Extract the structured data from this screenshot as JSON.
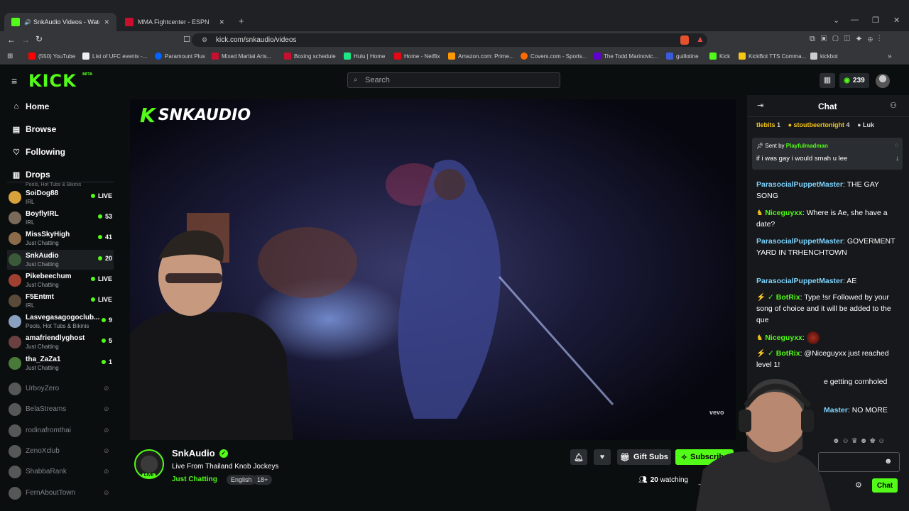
{
  "browser": {
    "tabs": [
      {
        "title": "SnkAudio Videos - Watch On",
        "active": true
      },
      {
        "title": "MMA Fightcenter - ESPN",
        "active": false
      }
    ],
    "url": "kick.com/snkaudio/videos",
    "bookmarks": [
      "(550) YouTube",
      "List of UFC events -...",
      "Paramount Plus",
      "Mixed Martial Arts...",
      "Boxing schedule",
      "Hulu | Home",
      "Home - Netflix",
      "Amazon.com: Prime...",
      "Covers.com - Sports...",
      "The Todd Marinovic...",
      "guillotine",
      "Kick",
      "KickBot TTS Comma..."
    ]
  },
  "header": {
    "logo": "KICK",
    "logo_badge": "BETA",
    "search_placeholder": "Search",
    "points": "239"
  },
  "sidebar": {
    "nav": [
      {
        "label": "Home",
        "icon": "home-icon"
      },
      {
        "label": "Browse",
        "icon": "browse-icon"
      },
      {
        "label": "Following",
        "icon": "heart-icon"
      },
      {
        "label": "Drops",
        "icon": "drops-icon"
      }
    ],
    "cutoff_category": "Pools, Hot Tubs & Bikinis",
    "channels": [
      {
        "name": "SoiDog88",
        "category": "IRL",
        "status": "LIVE"
      },
      {
        "name": "BoyflyIRL",
        "category": "IRL",
        "status": "53"
      },
      {
        "name": "MissSkyHigh",
        "category": "Just Chatting",
        "status": "41"
      },
      {
        "name": "SnkAudio",
        "category": "Just Chatting",
        "status": "20"
      },
      {
        "name": "Pikebeechum",
        "category": "Just Chatting",
        "status": "LIVE"
      },
      {
        "name": "F5Entmt",
        "category": "IRL",
        "status": "LIVE"
      },
      {
        "name": "Lasvegasagogoclub...",
        "category": "Pools, Hot Tubs & Bikinis",
        "status": "9"
      },
      {
        "name": "amafriendlyghost",
        "category": "Just Chatting",
        "status": "5"
      },
      {
        "name": "tha_ZaZa1",
        "category": "Just Chatting",
        "status": "1"
      }
    ],
    "offline": [
      "UrboyZero",
      "BelaStreams",
      "rodinafromthai",
      "ZenoXclub",
      "ShabbaRank",
      "FernAboutTown"
    ]
  },
  "video": {
    "watermark": "SNKAUDIO",
    "vevo": "vevo"
  },
  "stream": {
    "channel_name": "SnkAudio",
    "title": "Live From Thailand Knob Jockeys",
    "category": "Just Chatting",
    "tags": [
      "English",
      "18+"
    ],
    "live_badge": "LIVE",
    "gift_label": "Gift Subs",
    "subscribe_label": "Subscribe",
    "viewers": "20",
    "watching_label": "watching"
  },
  "chat": {
    "title": "Chat",
    "gifters": [
      {
        "name": "tlebits",
        "count": "1"
      },
      {
        "name": "stoutbeertonight",
        "count": "4"
      },
      {
        "name": "Luk",
        "count": ""
      }
    ],
    "pinned_prefix": "Sent by",
    "pinned_user": "Playfulmadman",
    "pinned_text": "if i was gay i would smah u lee",
    "messages": [
      {
        "user": "ParasocialPuppetMaster",
        "text": "THE GAY SONG",
        "color": "#7dd3fc"
      },
      {
        "user": "Niceguyxx",
        "text": "Where is Ae, she have a date?",
        "color": "#53fc18"
      },
      {
        "user": "ParasocialPuppetMaster",
        "text": "GOVERMENT YARD IN TRHENCHTOWN",
        "color": "#7dd3fc"
      },
      {
        "user": "ParasocialPuppetMaster",
        "text": "AE",
        "color": "#7dd3fc"
      },
      {
        "user": "BotRix",
        "text": "Type !sr Followed by your song of choice and it will be added to the que",
        "color": "#53fc18"
      },
      {
        "user": "Niceguyxx",
        "text": "",
        "color": "#53fc18"
      },
      {
        "user": "BotRix",
        "text": "@Niceguyxx just reached level 1!",
        "color": "#53fc18"
      },
      {
        "user": "",
        "text": "e getting cornholed",
        "color": "#7dd3fc"
      },
      {
        "user": "Master",
        "text": "NO MORE",
        "color": "#7dd3fc"
      }
    ],
    "send_label": "Chat"
  }
}
